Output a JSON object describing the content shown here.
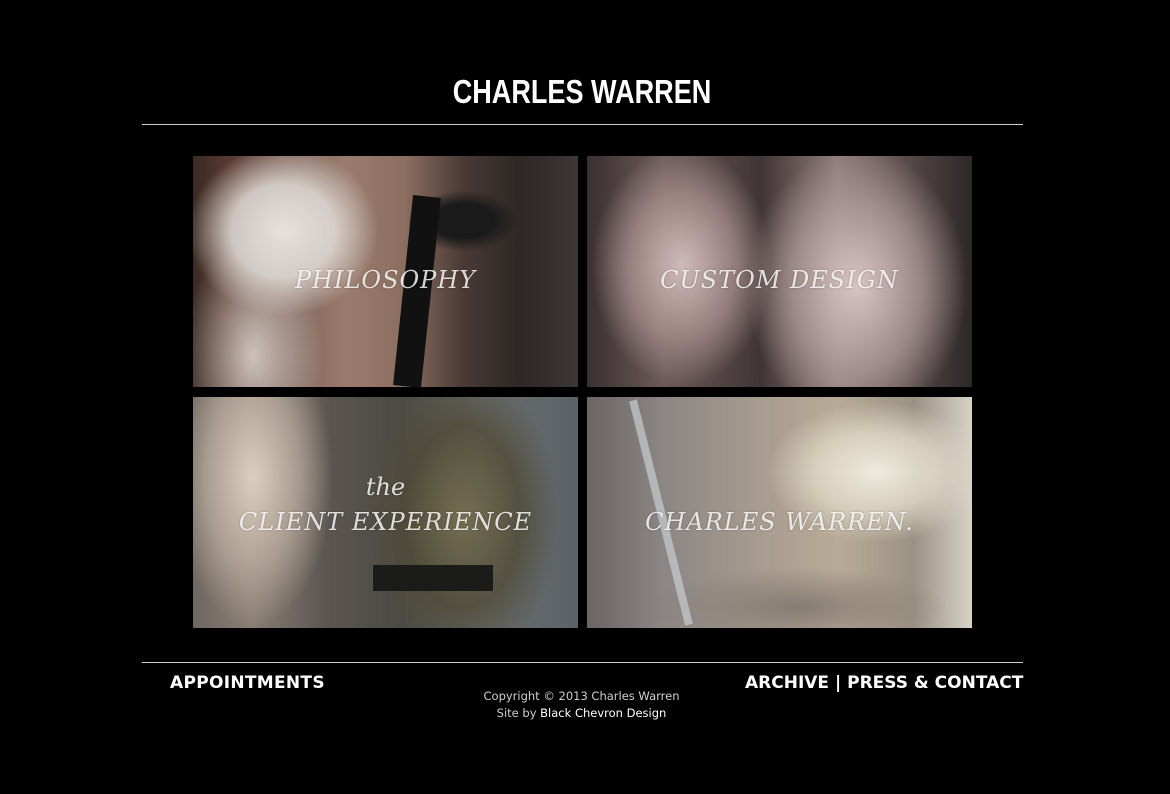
{
  "header": {
    "title": "CHARLES WARREN"
  },
  "tiles": [
    {
      "id": "philosophy",
      "line1": "",
      "line2": "PHILOSOPHY"
    },
    {
      "id": "custom",
      "line1": "",
      "line2": "CUSTOM DESIGN"
    },
    {
      "id": "client",
      "line1": "the",
      "line2": "CLIENT EXPERIENCE"
    },
    {
      "id": "charles",
      "line1": "",
      "line2": "CHARLES WARREN."
    }
  ],
  "footer": {
    "appointments": "APPOINTMENTS",
    "archive": "ARCHIVE",
    "separator": "|",
    "press_contact": "PRESS & CONTACT",
    "copyright": "Copyright © 2013 Charles Warren",
    "site_by_prefix": "Site by",
    "site_by_link": "Black Chevron Design"
  }
}
